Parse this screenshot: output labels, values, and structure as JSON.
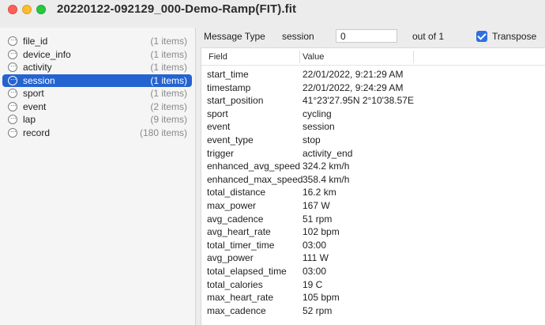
{
  "window": {
    "title": "20220122-092129_000-Demo-Ramp(FIT).fit"
  },
  "sidebar": {
    "items": [
      {
        "label": "file_id",
        "count": "(1 items)"
      },
      {
        "label": "device_info",
        "count": "(1 items)"
      },
      {
        "label": "activity",
        "count": "(1 items)"
      },
      {
        "label": "session",
        "count": "(1 items)",
        "selected": true
      },
      {
        "label": "sport",
        "count": "(1 items)"
      },
      {
        "label": "event",
        "count": "(2 items)"
      },
      {
        "label": "lap",
        "count": "(9 items)"
      },
      {
        "label": "record",
        "count": "(180 items)"
      }
    ]
  },
  "toolbar": {
    "message_type_label": "Message Type",
    "message_type_value": "session",
    "index_value": "0",
    "out_of_label": "out of 1",
    "transpose_label": "Transpose",
    "transpose_checked": true
  },
  "table": {
    "headers": [
      "Field",
      "Value"
    ],
    "rows": [
      {
        "field": "start_time",
        "value": "22/01/2022, 9:21:29 AM"
      },
      {
        "field": "timestamp",
        "value": "22/01/2022, 9:24:29 AM"
      },
      {
        "field": "start_position",
        "value": "41°23'27.95N 2°10'38.57E"
      },
      {
        "field": "sport",
        "value": "cycling"
      },
      {
        "field": "event",
        "value": "session"
      },
      {
        "field": "event_type",
        "value": "stop"
      },
      {
        "field": "trigger",
        "value": "activity_end"
      },
      {
        "field": "enhanced_avg_speed",
        "value": "324.2 km/h"
      },
      {
        "field": "enhanced_max_speed",
        "value": "358.4 km/h"
      },
      {
        "field": "total_distance",
        "value": "16.2 km"
      },
      {
        "field": "max_power",
        "value": "167 W"
      },
      {
        "field": "avg_cadence",
        "value": "51 rpm"
      },
      {
        "field": "avg_heart_rate",
        "value": "102 bpm"
      },
      {
        "field": "total_timer_time",
        "value": "03:00"
      },
      {
        "field": "avg_power",
        "value": "111 W"
      },
      {
        "field": "total_elapsed_time",
        "value": "03:00"
      },
      {
        "field": "total_calories",
        "value": "19 C"
      },
      {
        "field": "max_heart_rate",
        "value": "105 bpm"
      },
      {
        "field": "max_cadence",
        "value": "52 rpm"
      }
    ]
  },
  "colors": {
    "selection": "#2563d0",
    "checkbox": "#2f6fe0"
  }
}
